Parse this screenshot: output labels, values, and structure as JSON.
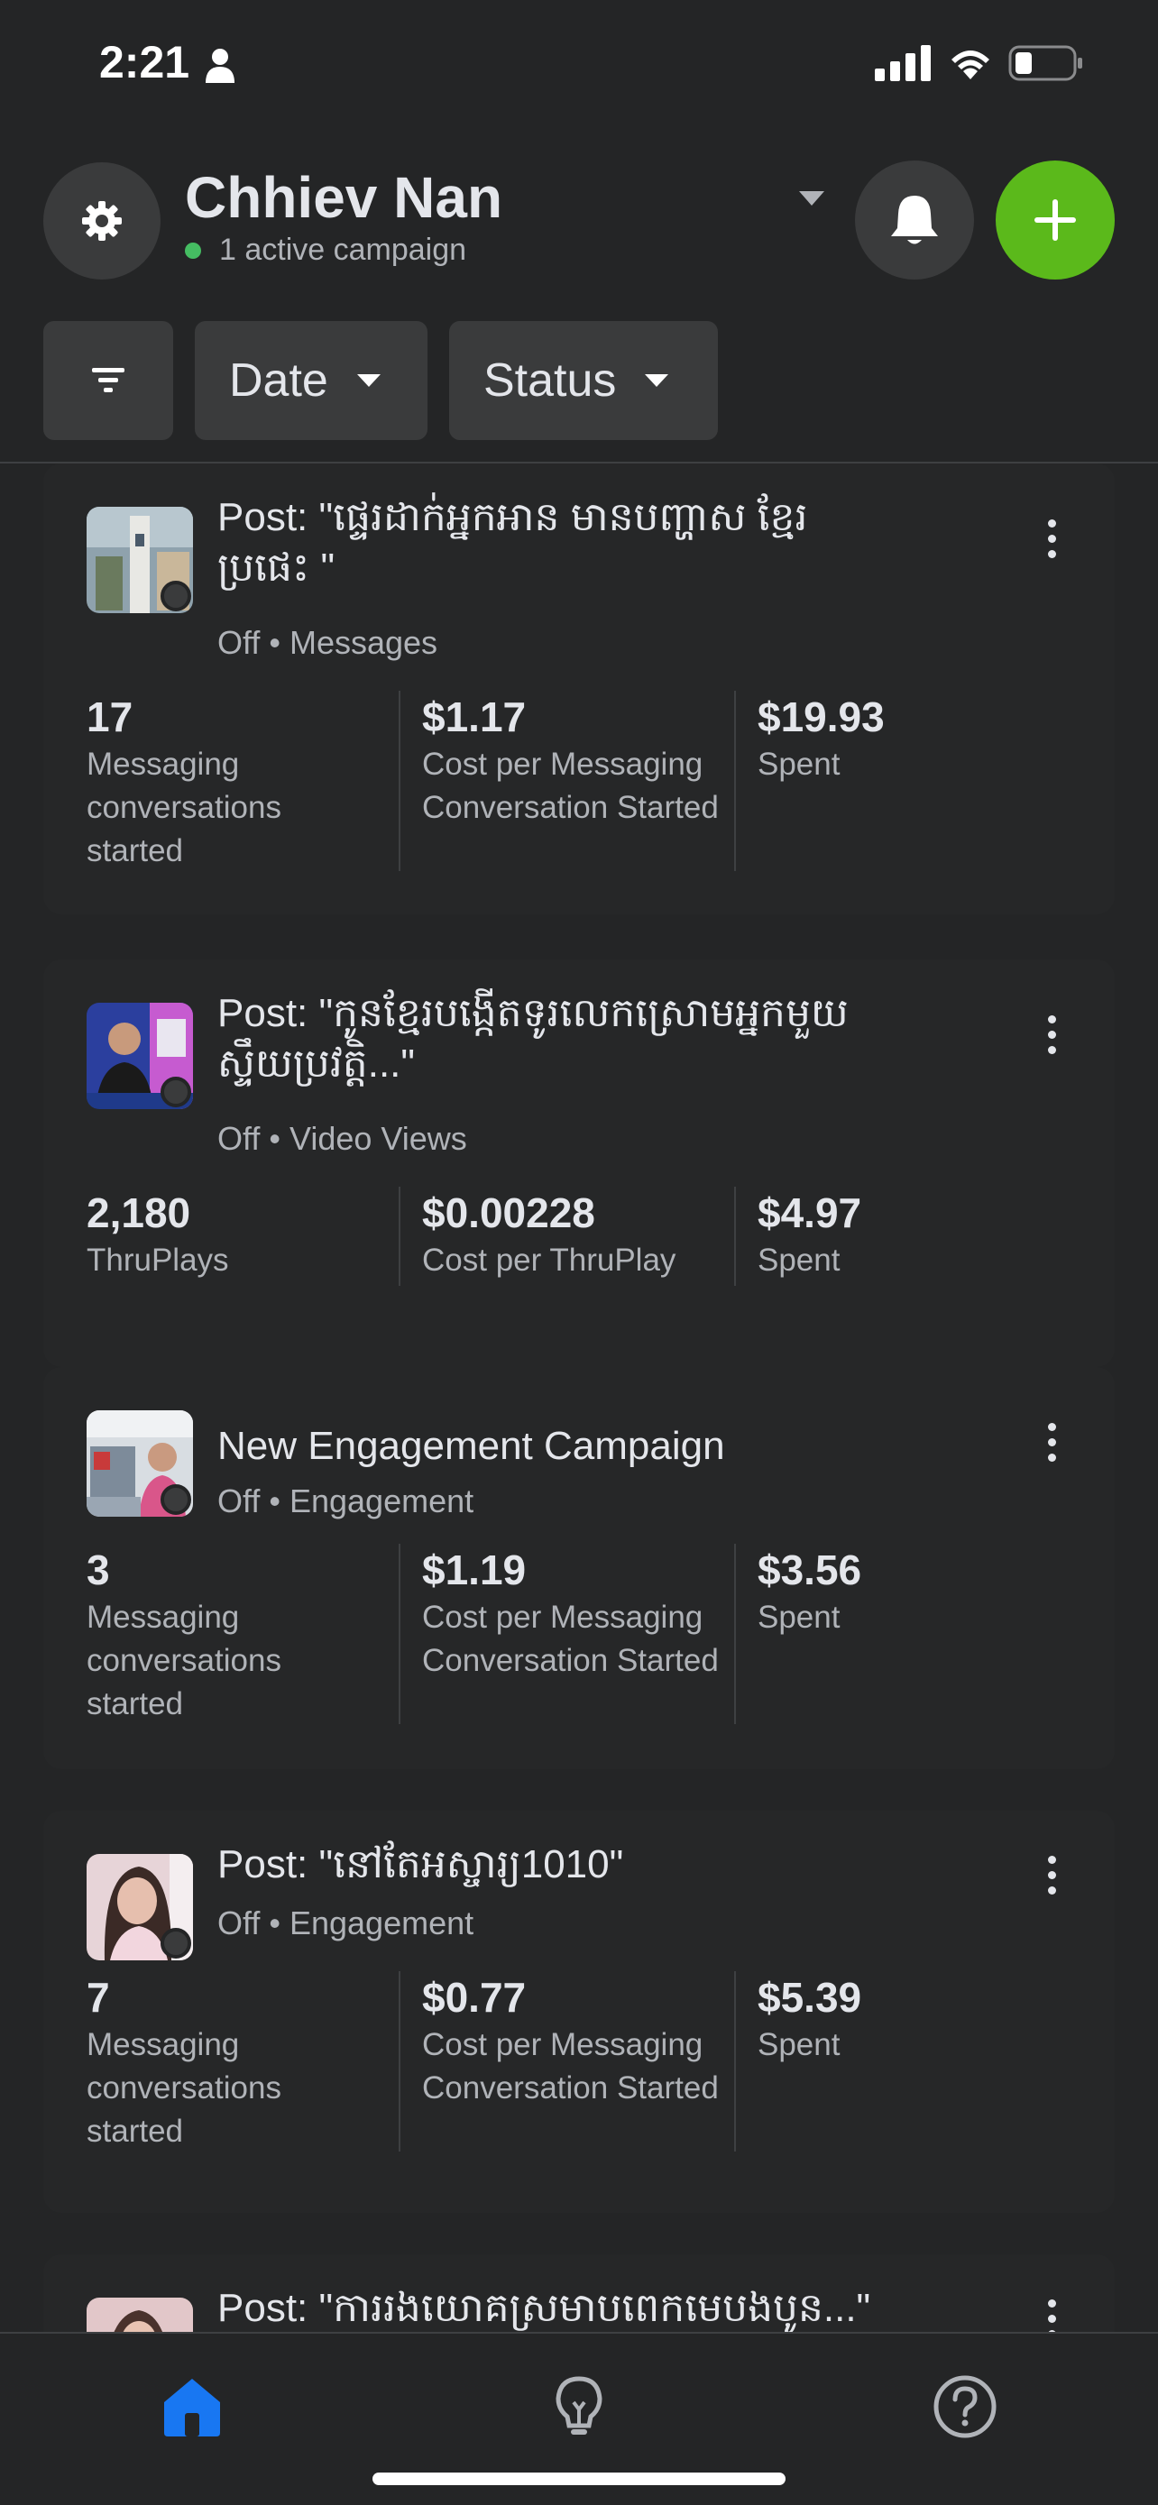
{
  "status_bar": {
    "time": "2:21"
  },
  "header": {
    "account_name": "Chhiev Nan",
    "account_status": "1 active campaign"
  },
  "filters": {
    "date_label": "Date",
    "status_label": "Status"
  },
  "colors": {
    "background": "#242526",
    "surface": "#3a3b3c",
    "accent_green": "#5bb91b",
    "active_dot": "#45bd62",
    "nav_active": "#1877f2"
  },
  "campaigns": [
    {
      "title_line1": "Post: \"ផ្ទេរដាក់អ្នកអាន មានបញ្ហាស ខ្មែរ",
      "title_line2": "ប្រផេះ \"",
      "status": "Off",
      "objective": "Messages",
      "metrics": [
        {
          "value": "17",
          "label": "Messaging conversations started"
        },
        {
          "value": "$1.17",
          "label": "Cost per Messaging Conversation Started"
        },
        {
          "value": "$19.93",
          "label": "Spent"
        }
      ]
    },
    {
      "title_line1": "Post: \"កូនខ្មែរបង្កើតទូរលេកស្រោមអ្នកមួយ",
      "title_line2": "ស្ទឹយប្រវត្តិ...\"",
      "status": "Off",
      "objective": "Video Views",
      "metrics": [
        {
          "value": "2,180",
          "label": "ThruPlays"
        },
        {
          "value": "$0.00228",
          "label": "Cost per ThruPlay"
        },
        {
          "value": "$4.97",
          "label": "Spent"
        }
      ]
    },
    {
      "title_line1": "New Engagement Campaign",
      "status": "Off",
      "objective": "Engagement",
      "metrics": [
        {
          "value": "3",
          "label": "Messaging conversations started"
        },
        {
          "value": "$1.19",
          "label": "Cost per Messaging Conversation Started"
        },
        {
          "value": "$3.56",
          "label": "Spent"
        }
      ]
    },
    {
      "title_line1": "Post: \"នៅតែអស្ចារ្យ1010\"",
      "status": "Off",
      "objective": "Engagement",
      "metrics": [
        {
          "value": "7",
          "label": "Messaging conversations started"
        },
        {
          "value": "$0.77",
          "label": "Cost per Messaging Conversation Started"
        },
        {
          "value": "$5.39",
          "label": "Spent"
        }
      ]
    },
    {
      "title_line1": "Post: \"ការរងយោគស្រមាបពេកមេបងបូន...\""
    }
  ],
  "bottom_nav": {
    "items": [
      {
        "icon": "home-icon",
        "active": true
      },
      {
        "icon": "lightbulb-icon",
        "active": false
      },
      {
        "icon": "help-icon",
        "active": false
      }
    ]
  }
}
